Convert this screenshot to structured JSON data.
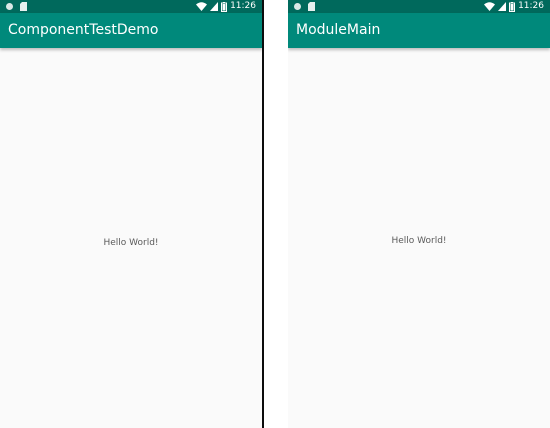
{
  "colors": {
    "status_bar": "#00695c",
    "app_bar": "#00897b",
    "background": "#fafafa",
    "divider": "#0c0c0c"
  },
  "phones": [
    {
      "status": {
        "time": "11:26",
        "icons_left": [
          "circle-icon",
          "sd-card-icon"
        ],
        "icons_right": [
          "wifi-icon",
          "signal-icon",
          "battery-icon"
        ]
      },
      "app_bar": {
        "title": "ComponentTestDemo"
      },
      "content": {
        "text": "Hello World!"
      }
    },
    {
      "status": {
        "time": "11:26",
        "icons_left": [
          "circle-icon",
          "sd-card-icon"
        ],
        "icons_right": [
          "wifi-icon",
          "signal-icon",
          "battery-icon"
        ]
      },
      "app_bar": {
        "title": "ModuleMain"
      },
      "content": {
        "text": "Hello World!"
      }
    }
  ]
}
